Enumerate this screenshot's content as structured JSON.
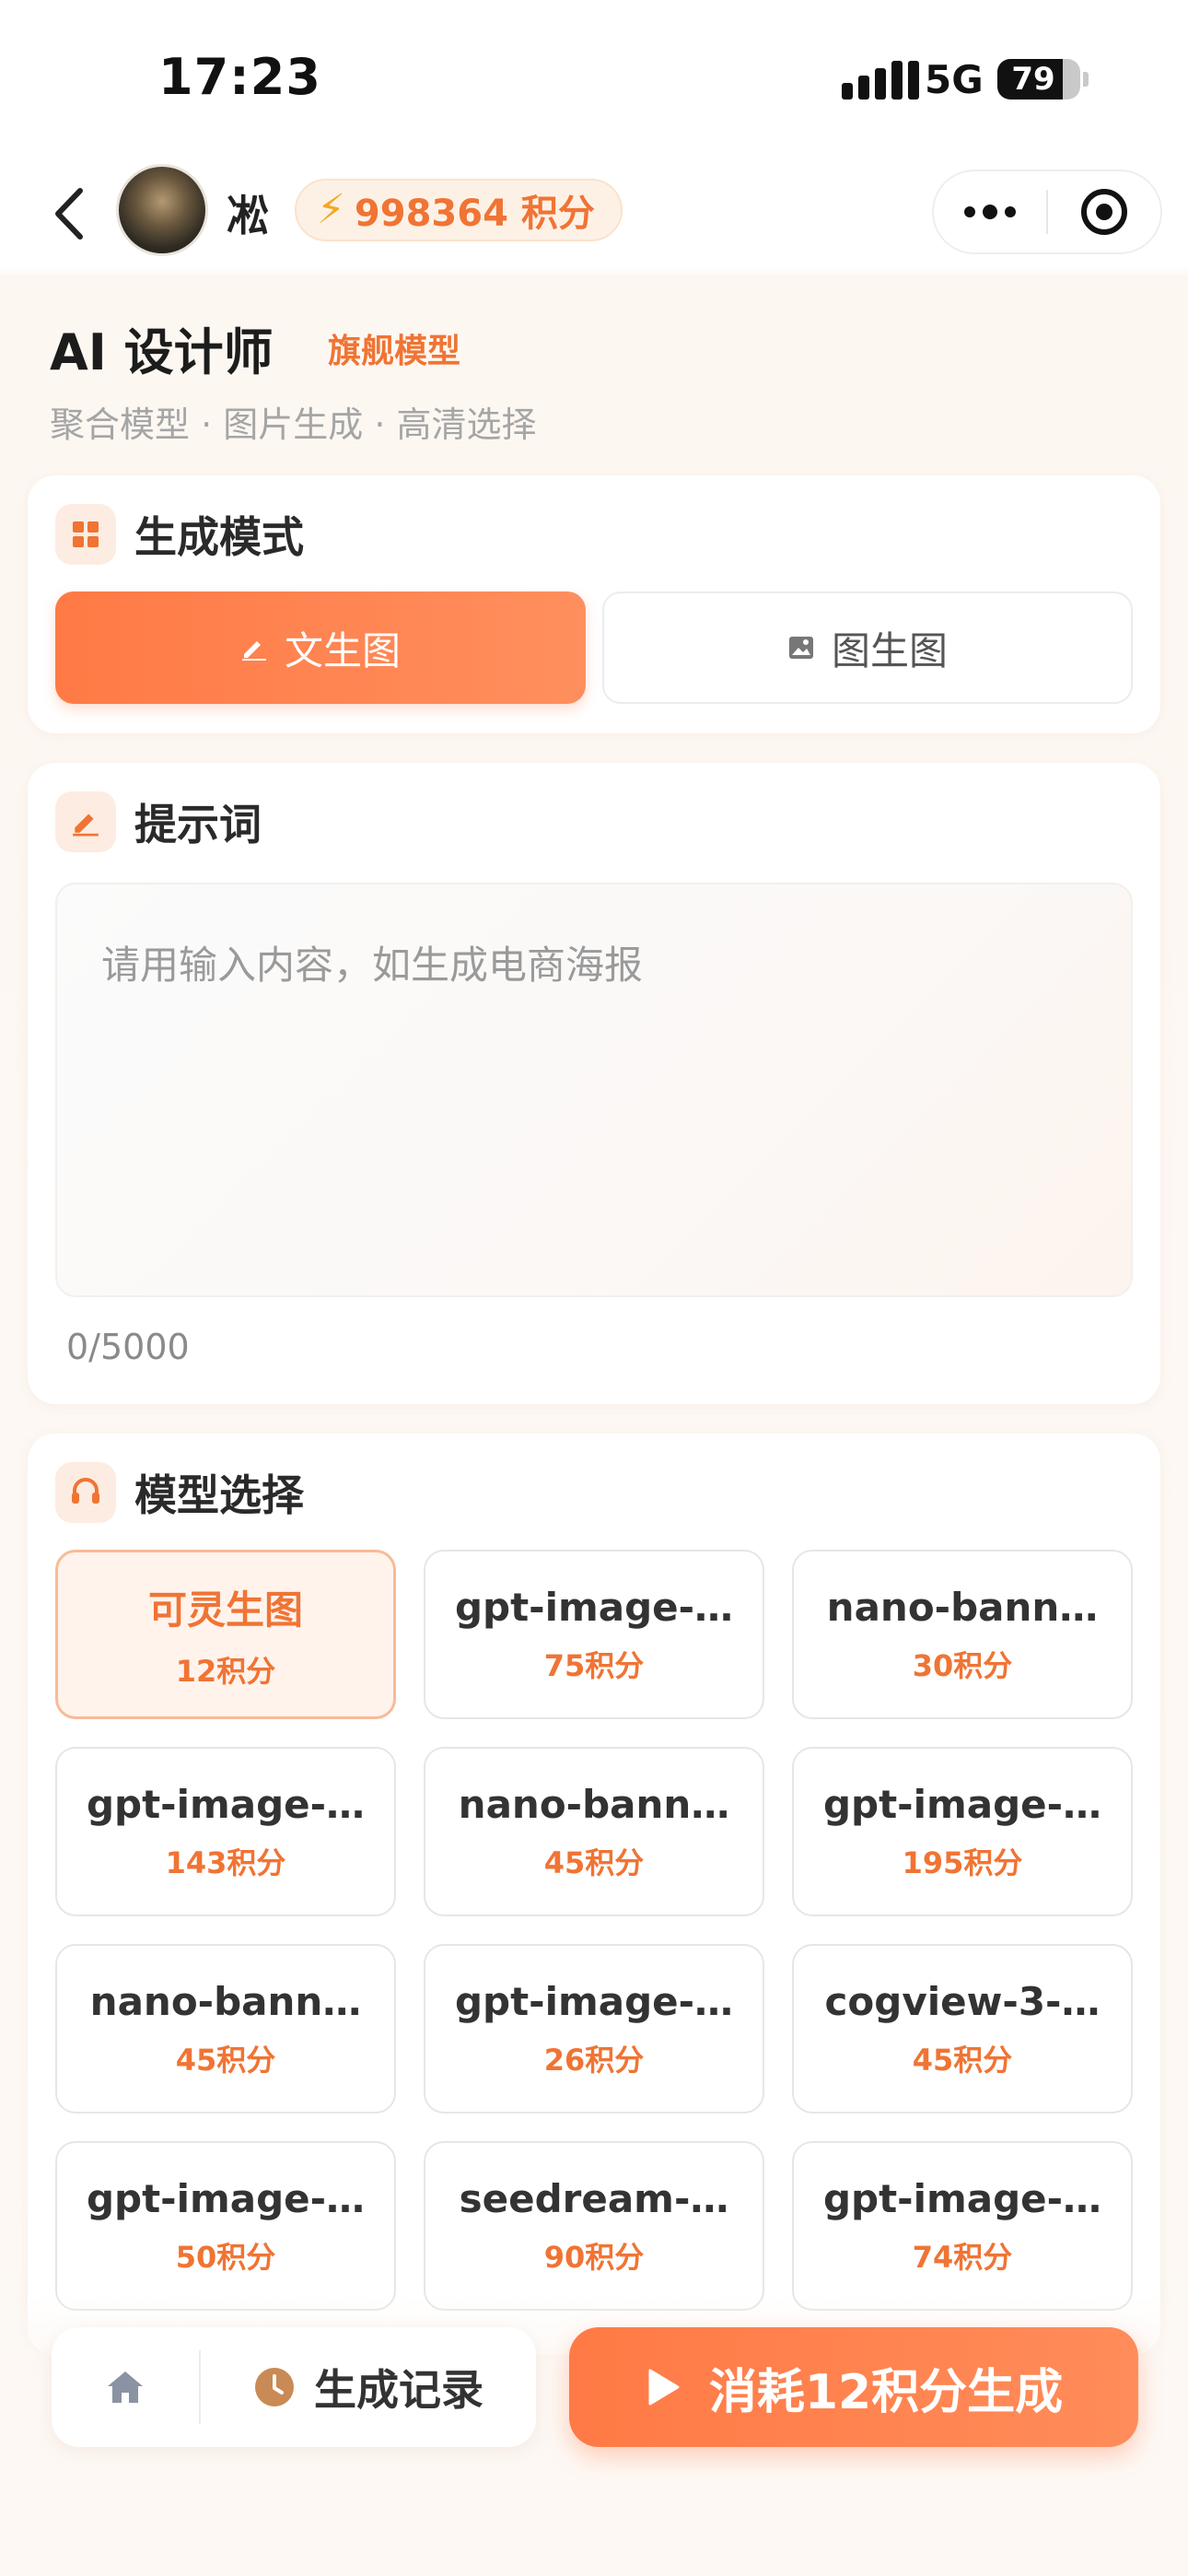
{
  "status_bar": {
    "time": "17:23",
    "network": "5G",
    "battery_percent": "79",
    "battery_level": 0.79
  },
  "header": {
    "back_icon": "chevron-left-icon",
    "avatar_icon": "user-avatar",
    "username": "凇",
    "points_icon": "lightning-icon",
    "points_text": "998364 积分",
    "more_icon": "more-dots-icon",
    "close_icon": "target-circle-icon"
  },
  "title_area": {
    "title": "AI 设计师",
    "badge": "旗舰模型",
    "subtitle": "聚合模型 · 图片生成 · 高清选择"
  },
  "mode_section": {
    "title": "生成模式",
    "icon": "grid-icon",
    "modes": [
      {
        "label": "文生图",
        "icon": "pencil-icon",
        "active": true
      },
      {
        "label": "图生图",
        "icon": "image-icon",
        "active": false
      }
    ]
  },
  "prompt_section": {
    "title": "提示词",
    "icon": "pencil-icon",
    "placeholder": "请用输入内容，如生成电商海报",
    "value": "",
    "char_count": "0/5000"
  },
  "model_section": {
    "title": "模型选择",
    "icon": "headset-icon",
    "models": [
      {
        "name": "可灵生图",
        "cost": "12积分",
        "selected": true
      },
      {
        "name": "gpt-image-…",
        "cost": "75积分",
        "selected": false
      },
      {
        "name": "nano-bann…",
        "cost": "30积分",
        "selected": false
      },
      {
        "name": "gpt-image-…",
        "cost": "143积分",
        "selected": false
      },
      {
        "name": "nano-bann…",
        "cost": "45积分",
        "selected": false
      },
      {
        "name": "gpt-image-…",
        "cost": "195积分",
        "selected": false
      },
      {
        "name": "nano-bann…",
        "cost": "45积分",
        "selected": false
      },
      {
        "name": "gpt-image-…",
        "cost": "26积分",
        "selected": false
      },
      {
        "name": "cogview-3-…",
        "cost": "45积分",
        "selected": false
      },
      {
        "name": "gpt-image-…",
        "cost": "50积分",
        "selected": false
      },
      {
        "name": "seedream-…",
        "cost": "90积分",
        "selected": false
      },
      {
        "name": "gpt-image-…",
        "cost": "74积分",
        "selected": false
      }
    ]
  },
  "bottom_bar": {
    "home_icon": "home-icon",
    "history_icon": "clock-icon",
    "history_label": "生成记录",
    "generate_icon": "play-icon",
    "generate_label": "消耗12积分生成"
  },
  "colors": {
    "accent": "#ff7a45",
    "accent_text": "#f07434",
    "points_bg": "#fdf1e6",
    "selected_bg": "#fff3ec"
  }
}
